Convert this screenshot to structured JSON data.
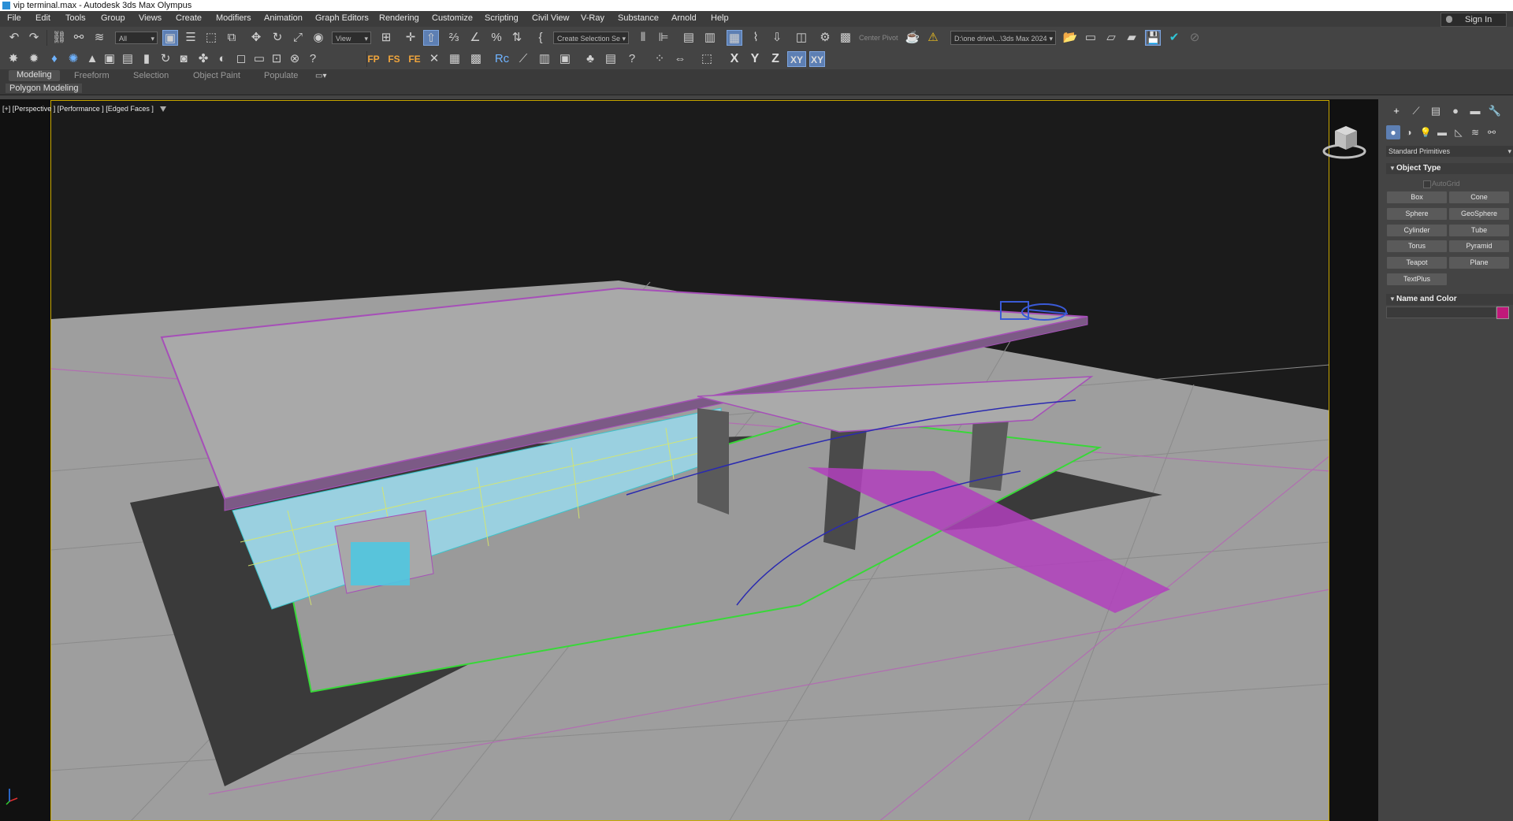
{
  "window": {
    "title": "vip terminal.max - Autodesk 3ds Max Olympus"
  },
  "menu": [
    "File",
    "Edit",
    "Tools",
    "Group",
    "Views",
    "Create",
    "Modifiers",
    "Animation",
    "Graph Editors",
    "Rendering",
    "Customize",
    "Scripting",
    "Civil View",
    "V-Ray",
    "Substance",
    "Arnold",
    "Help"
  ],
  "account": {
    "signin_label": "Sign In"
  },
  "toolbar": {
    "selection_filter": "All",
    "ref_coord": "View",
    "named_selection": "Create Selection Se",
    "center_pivot": "Center Pivot",
    "project_path": "D:\\one drive\\...\\3ds Max 2024",
    "axis_x": "X",
    "axis_y": "Y",
    "axis_z": "Z",
    "axis_xy": "XY",
    "axis_xy2": "XY"
  },
  "ribbon": {
    "tabs": [
      "Modeling",
      "Freeform",
      "Selection",
      "Object Paint",
      "Populate"
    ],
    "active_tab": "Modeling",
    "sub_panel": "Polygon Modeling"
  },
  "viewport": {
    "label": "[+] [Perspective ] [Performance ] [Edged Faces ]"
  },
  "command_panel": {
    "category_dropdown": "Standard Primitives",
    "object_type_title": "Object Type",
    "autogrid_label": "AutoGrid",
    "primitives": [
      "Box",
      "Cone",
      "Sphere",
      "GeoSphere",
      "Cylinder",
      "Tube",
      "Torus",
      "Pyramid",
      "Teapot",
      "Plane",
      "TextPlus"
    ],
    "name_color_title": "Name and Color",
    "object_color": "#c0197a"
  }
}
